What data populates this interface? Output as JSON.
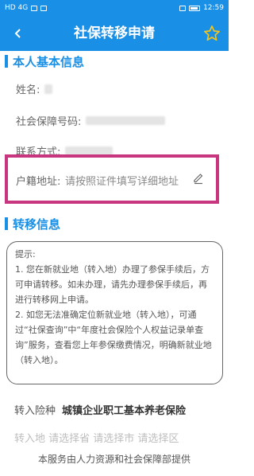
{
  "status_bar": {
    "carrier": "HD 4G",
    "time": "12:59"
  },
  "header": {
    "title": "社保转移申请",
    "back_icon": "chevron-left-icon",
    "favorite_icon": "star-outline-icon"
  },
  "personal": {
    "section_title": "本人基本信息",
    "name_label": "姓名:",
    "ss_number_label": "社会保障号码:",
    "contact_label": "联系方式:",
    "address_label": "户籍地址:",
    "address_placeholder": "请按照证件填写详细地址"
  },
  "transfer": {
    "section_title": "转移信息",
    "tips_heading": "提示:",
    "tip_1": "1. 您在新就业地（转入地）办理了参保手续后，方可申请转移。如未办理，请先办理参保手续后，再进行转移网上申请。",
    "tip_2": "2. 如您无法准确定位新就业地（转入地），可通过“社保查询”中“年度社会保险个人权益记录单查询”服务，查看您上年参保缴费情况，明确新就业地（转入地）。",
    "insurance_label": "转入险种",
    "insurance_value": "城镇企业职工基本养老保险",
    "partial_row_text": "转入地 请选择省 请选择市 请选择区"
  },
  "footer": {
    "text": "本服务由人力资源和社会保障部提供"
  },
  "colors": {
    "primary": "#1a8fe6",
    "highlight": "#c8367f"
  }
}
